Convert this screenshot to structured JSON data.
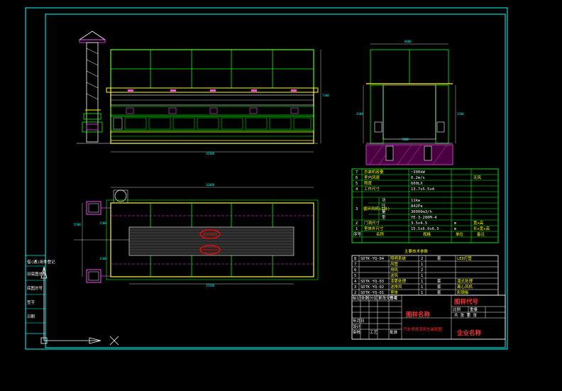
{
  "colors": {
    "background": "#000000",
    "frame": "#00ffff",
    "main_structure": "#ffff00",
    "panels": "#00ff00",
    "ducts": "#ff40ff",
    "highlights": "#ff0000",
    "text": "#ffffff"
  },
  "dimensions": {
    "front_width": "16300",
    "front_height": "7300",
    "side_top": "6000",
    "side_height_left": "4300",
    "side_height_right": "3200",
    "side_bottom": "7000",
    "plan_total": "16000",
    "plan_inner": "15500",
    "plan_depth": "5500",
    "plan_side_a": "1500",
    "plan_side_b": "1500"
  },
  "spec_table": {
    "rows": [
      {
        "no": "7",
        "name": "总装机容量",
        "value": "~300kW",
        "unit": "",
        "remark": ""
      },
      {
        "no": "6",
        "name": "室内风速",
        "value": "0.2m/s",
        "unit": "",
        "remark": "无风"
      },
      {
        "no": "5",
        "name": "照度",
        "value": "600LX",
        "unit": "",
        "remark": ""
      },
      {
        "no": "4",
        "name": "工作尺寸",
        "value": "13.7x5.5x4",
        "unit": "",
        "remark": ""
      },
      {
        "no": "2",
        "name": "门洞尺寸",
        "value": "3.5x4.5",
        "unit": "m",
        "remark": "宽x高"
      },
      {
        "no": "1",
        "name": "室体外尺寸",
        "value": "15.5x6.0x6.5",
        "unit": "m",
        "remark": "长x宽x高"
      }
    ],
    "row3": {
      "no": "3",
      "name": "循环风机(2台)",
      "sub": [
        {
          "label": "功",
          "value": "11kw"
        },
        {
          "label": "压",
          "value": "842Pa"
        },
        {
          "label": "量",
          "value": "30000m3/h"
        },
        {
          "label": "型",
          "value": "YE-3-280M-4"
        }
      ]
    },
    "header": {
      "no": "序号",
      "name": "名称",
      "value": "规格",
      "unit": "单位",
      "remark": "备注"
    },
    "caption": "主要技术参数"
  },
  "bom_table": {
    "rows": [
      {
        "no": "8",
        "code": "SDTK-YQ-04",
        "name": "照明系统",
        "qty": "2",
        "unit": "套",
        "remark": "LED灯管"
      },
      {
        "no": "7",
        "code": "",
        "name": "风管",
        "qty": "1",
        "unit": "",
        "remark": ""
      },
      {
        "no": "6",
        "code": "",
        "name": "排风",
        "qty": "2",
        "unit": "",
        "remark": ""
      },
      {
        "no": "5",
        "code": "",
        "name": "送风",
        "qty": "1",
        "unit": "",
        "remark": ""
      },
      {
        "no": "4",
        "code": "SDTK-YQ-03",
        "name": "漆雾处理",
        "qty": "1",
        "unit": "套",
        "remark": "湿式处理"
      },
      {
        "no": "3",
        "code": "SDTK-YQ-02",
        "name": "送排风",
        "qty": "1",
        "unit": "套",
        "remark": "离心风机"
      },
      {
        "no": "2",
        "code": "SDTK-YQ-01",
        "name": "室体",
        "qty": "1",
        "unit": "套",
        "remark": "彩钢板"
      }
    ]
  },
  "title_block": {
    "drawing_name_label": "图样名称",
    "drawing_no_label": "图样代号",
    "company_label": "企业名称",
    "product_label": "汽车喷烤漆房总装配图",
    "small_fields": [
      "标记",
      "处数",
      "分区",
      "更改文件号",
      "签名",
      "年月日",
      "设计",
      "审核",
      "工艺",
      "批准"
    ],
    "scale_label": "比例",
    "weight_label": "重量",
    "sheet_label": "共 张 第 张"
  },
  "left_strip": {
    "labels": [
      "借(通)用件登记",
      "旧底图总号",
      "底图总号",
      "签字",
      "日期"
    ]
  }
}
